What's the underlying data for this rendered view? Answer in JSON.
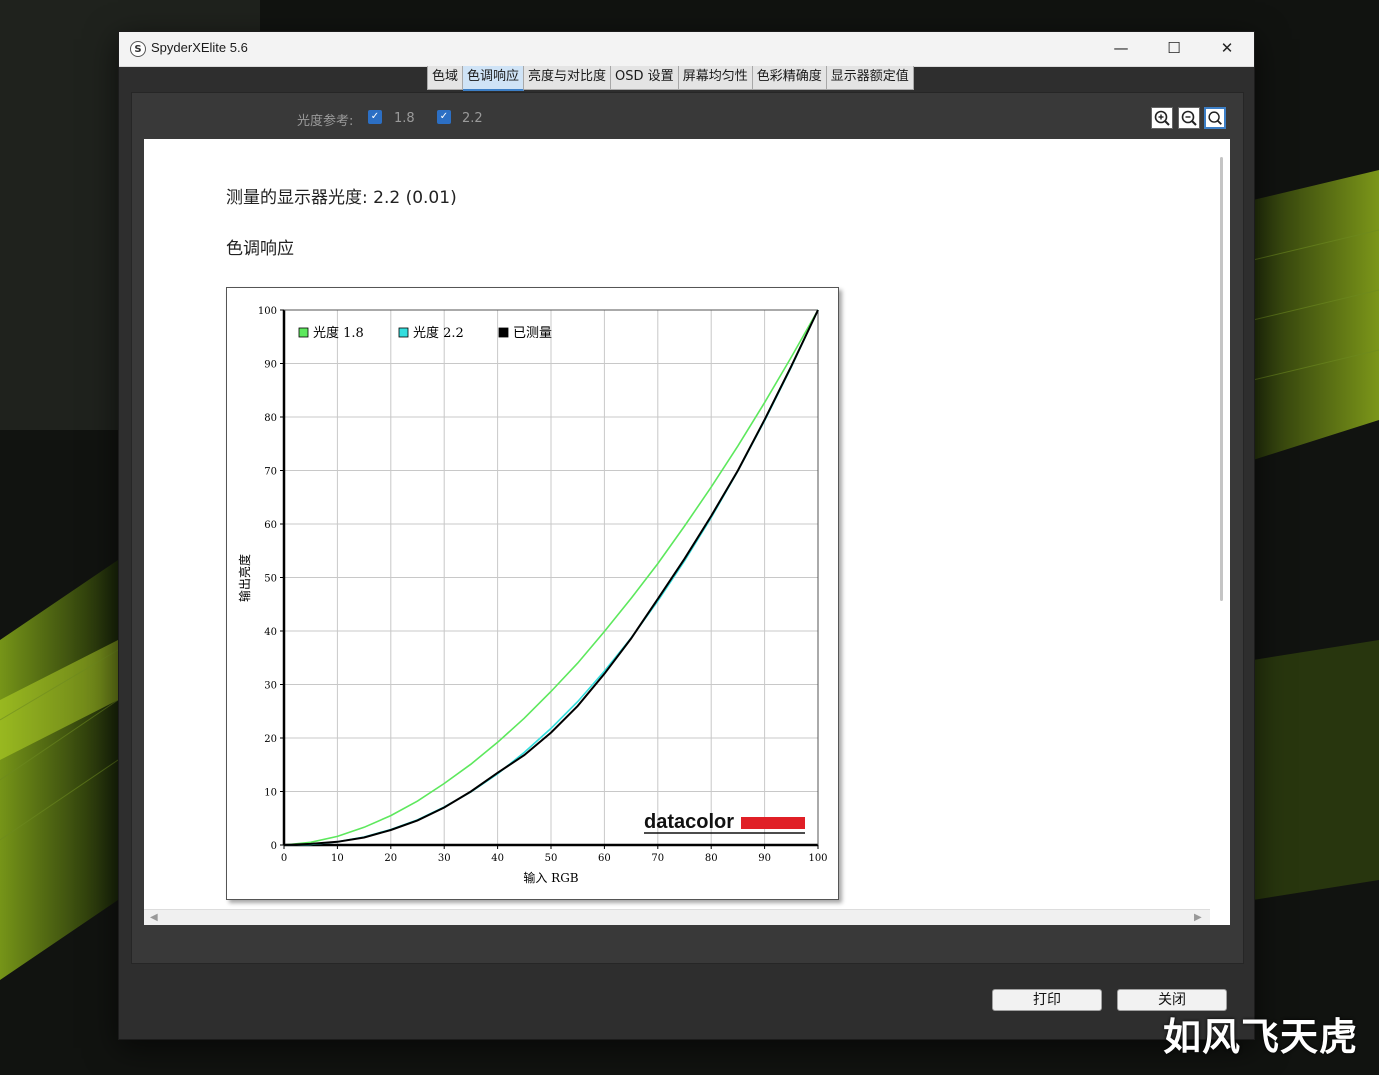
{
  "window": {
    "title": "SpyderXElite 5.6",
    "minimize_glyph": "—",
    "maximize_glyph": "☐",
    "close_glyph": "✕",
    "app_icon_glyph": "S"
  },
  "tabs": [
    {
      "label": "色域",
      "active": false
    },
    {
      "label": "色调响应",
      "active": true
    },
    {
      "label": "亮度与对比度",
      "active": false
    },
    {
      "label": "OSD 设置",
      "active": false
    },
    {
      "label": "屏幕均匀性",
      "active": false
    },
    {
      "label": "色彩精确度",
      "active": false
    },
    {
      "label": "显示器额定值",
      "active": false
    }
  ],
  "toolbar": {
    "gamma_label": "光度参考:",
    "options": [
      {
        "label": "1.8",
        "checked": true
      },
      {
        "label": "2.2",
        "checked": true
      }
    ],
    "zoom_in_icon": "zoom-in-icon",
    "zoom_out_icon": "zoom-out-icon",
    "zoom_fit_icon": "zoom-fit-icon"
  },
  "report": {
    "measured_label": "测量的显示器光度:",
    "measured_value": "2.2 (0.01)",
    "section_title": "色调响应"
  },
  "chart_data": {
    "type": "line",
    "xlabel": "输入 RGB",
    "ylabel": "输出亮度",
    "xlim": [
      0,
      100
    ],
    "ylim": [
      0,
      100
    ],
    "xticks": [
      0,
      10,
      20,
      30,
      40,
      50,
      60,
      70,
      80,
      90,
      100
    ],
    "yticks": [
      0,
      10,
      20,
      30,
      40,
      50,
      60,
      70,
      80,
      90,
      100
    ],
    "grid": true,
    "legend_position": "top-left",
    "series": [
      {
        "name": "光度 1.8",
        "color": "#5de85d",
        "gamma": 1.8,
        "x": [
          0,
          5,
          10,
          15,
          20,
          25,
          30,
          35,
          40,
          45,
          50,
          55,
          60,
          65,
          70,
          75,
          80,
          85,
          90,
          95,
          100
        ],
        "y": [
          0,
          0.5,
          1.6,
          3.3,
          5.5,
          8.2,
          11.5,
          15.1,
          19.2,
          23.7,
          28.7,
          34.0,
          39.9,
          46.1,
          52.6,
          59.6,
          66.9,
          74.6,
          82.7,
          91.2,
          100
        ]
      },
      {
        "name": "光度 2.2",
        "color": "#33dede",
        "gamma": 2.2,
        "x": [
          0,
          5,
          10,
          15,
          20,
          25,
          30,
          35,
          40,
          45,
          50,
          55,
          60,
          65,
          70,
          75,
          80,
          85,
          90,
          95,
          100
        ],
        "y": [
          0,
          0.1,
          0.6,
          1.5,
          2.9,
          4.7,
          7.1,
          9.9,
          13.3,
          17.3,
          21.8,
          26.8,
          32.5,
          38.7,
          45.6,
          53.1,
          61.2,
          69.9,
          79.3,
          89.3,
          100
        ]
      },
      {
        "name": "已测量",
        "color": "#000000",
        "x": [
          0,
          5,
          10,
          15,
          20,
          25,
          30,
          35,
          40,
          45,
          50,
          55,
          60,
          65,
          70,
          75,
          80,
          85,
          90,
          95,
          100
        ],
        "y": [
          0,
          0.2,
          0.6,
          1.4,
          2.8,
          4.6,
          7.0,
          10.0,
          13.5,
          16.8,
          21.0,
          26.0,
          32.0,
          38.6,
          46.0,
          53.5,
          61.5,
          70.0,
          79.5,
          89.5,
          100
        ]
      }
    ]
  },
  "brand": {
    "logo_text": "datacolor",
    "logo_color": "#e01f26"
  },
  "buttons": {
    "print": "打印",
    "close": "关闭"
  },
  "watermark": "如风飞天虎"
}
